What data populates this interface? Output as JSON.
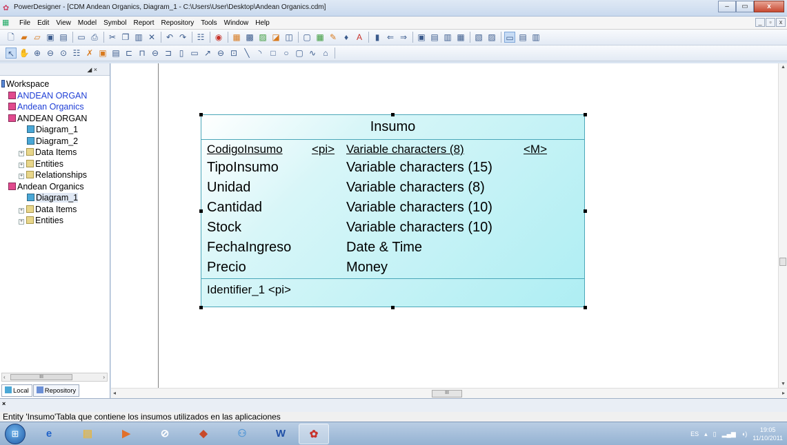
{
  "window": {
    "title": "PowerDesigner - [CDM Andean Organics, Diagram_1 - C:\\Users\\User\\Desktop\\Andean Organics.cdm]",
    "minimize": "–",
    "maximize": "▭",
    "close": "x"
  },
  "menu": {
    "items": [
      "File",
      "Edit",
      "View",
      "Model",
      "Symbol",
      "Report",
      "Repository",
      "Tools",
      "Window",
      "Help"
    ],
    "mdi_minimize": "_",
    "mdi_restore": "▫",
    "mdi_close": "x"
  },
  "toolbar1_icons": [
    "new-icon",
    "open-folder-icon",
    "open-icon",
    "save-icon",
    "save-all-icon",
    "print-preview-icon",
    "print-icon",
    "cut-icon",
    "copy-icon",
    "paste-icon",
    "delete-icon",
    "undo-icon",
    "redo-icon",
    "properties-icon",
    "find-icon",
    "model-icon",
    "merge-icon",
    "compare-icon",
    "check-icon",
    "generate-icon",
    "rect-icon",
    "grid-icon",
    "pen-icon",
    "fill-icon",
    "text-color-icon",
    "line-style-icon",
    "arrow-icon",
    "arrow-right-icon",
    "align-icon",
    "align2-icon",
    "align3-icon",
    "align4-icon",
    "align5-icon",
    "align6-icon",
    "view-icon",
    "view2-icon",
    "view3-icon"
  ],
  "toolbar2_icons": [
    "pointer-icon",
    "grabber-icon",
    "zoom-in-icon",
    "zoom-out-icon",
    "zoom-icon",
    "properties-icon",
    "delete-icon",
    "package-icon",
    "entity-icon",
    "relationship-icon",
    "inheritance-icon",
    "association-icon",
    "association-link-icon",
    "file-icon",
    "note-icon",
    "link-icon",
    "title-icon",
    "text-icon",
    "line-icon",
    "arc-icon",
    "rectangle-icon",
    "ellipse-icon",
    "rounded-rect-icon",
    "polyline-icon",
    "polygon-icon"
  ],
  "browser": {
    "header_controls": "◢ ×",
    "tree": [
      {
        "label": "Workspace",
        "icon": "workspace-icon",
        "level": 0,
        "blue": false
      },
      {
        "label": "ANDEAN ORGAN",
        "icon": "model-icon",
        "level": 1,
        "blue": true
      },
      {
        "label": "Andean Organics",
        "icon": "model-icon",
        "level": 1,
        "blue": true
      },
      {
        "label": "ANDEAN ORGAN",
        "icon": "model-icon",
        "level": 1,
        "blue": false
      },
      {
        "label": "Diagram_1",
        "icon": "diagram-icon",
        "level": 2,
        "blue": false
      },
      {
        "label": "Diagram_2",
        "icon": "diagram-icon",
        "level": 2,
        "blue": false
      },
      {
        "label": "Data Items",
        "icon": "folder-icon",
        "level": 2,
        "blue": false
      },
      {
        "label": "Entities",
        "icon": "folder-icon",
        "level": 2,
        "blue": false
      },
      {
        "label": "Relationships",
        "icon": "folder-icon",
        "level": 2,
        "blue": false
      },
      {
        "label": "Andean Organics",
        "icon": "model-icon",
        "level": 1,
        "blue": false
      },
      {
        "label": "Diagram_1",
        "icon": "diagram-icon",
        "level": 2,
        "blue": false,
        "selected": true
      },
      {
        "label": "Data Items",
        "icon": "folder-icon",
        "level": 2,
        "blue": false
      },
      {
        "label": "Entities",
        "icon": "folder-icon",
        "level": 2,
        "blue": false
      }
    ],
    "tabs": [
      "Local",
      "Repository"
    ]
  },
  "entity": {
    "name": "Insumo",
    "attributes": [
      {
        "name": "CodigoInsumo",
        "pi": "<pi>",
        "type": "Variable characters (8)",
        "mandatory": "<M>",
        "primary": true
      },
      {
        "name": "TipoInsumo",
        "type": "Variable characters (15)"
      },
      {
        "name": "Unidad",
        "type": "Variable characters (8)"
      },
      {
        "name": "Cantidad",
        "type": "Variable characters (10)"
      },
      {
        "name": "Stock",
        "type": "Variable characters (10)"
      },
      {
        "name": "FechaIngreso",
        "type": "Date & Time"
      },
      {
        "name": "Precio",
        "type": "Money"
      }
    ],
    "identifier": "Identifier_1 <pi>"
  },
  "status": {
    "text": "Entity 'Insumo'Tabla que contiene los insumos utilizados en las aplicaciones"
  },
  "taskbar": {
    "apps": [
      "internet-explorer-icon",
      "file-explorer-icon",
      "media-player-icon",
      "hp-icon",
      "app-icon",
      "people-icon",
      "word-icon",
      "powerdesigner-icon"
    ],
    "lang": "ES",
    "time": "19:05",
    "date": "11/10/2011"
  },
  "colors": {
    "entity_fill": "#aeeef3",
    "entity_border": "#4aa6b8",
    "link_blue": "#1f3fd6"
  }
}
